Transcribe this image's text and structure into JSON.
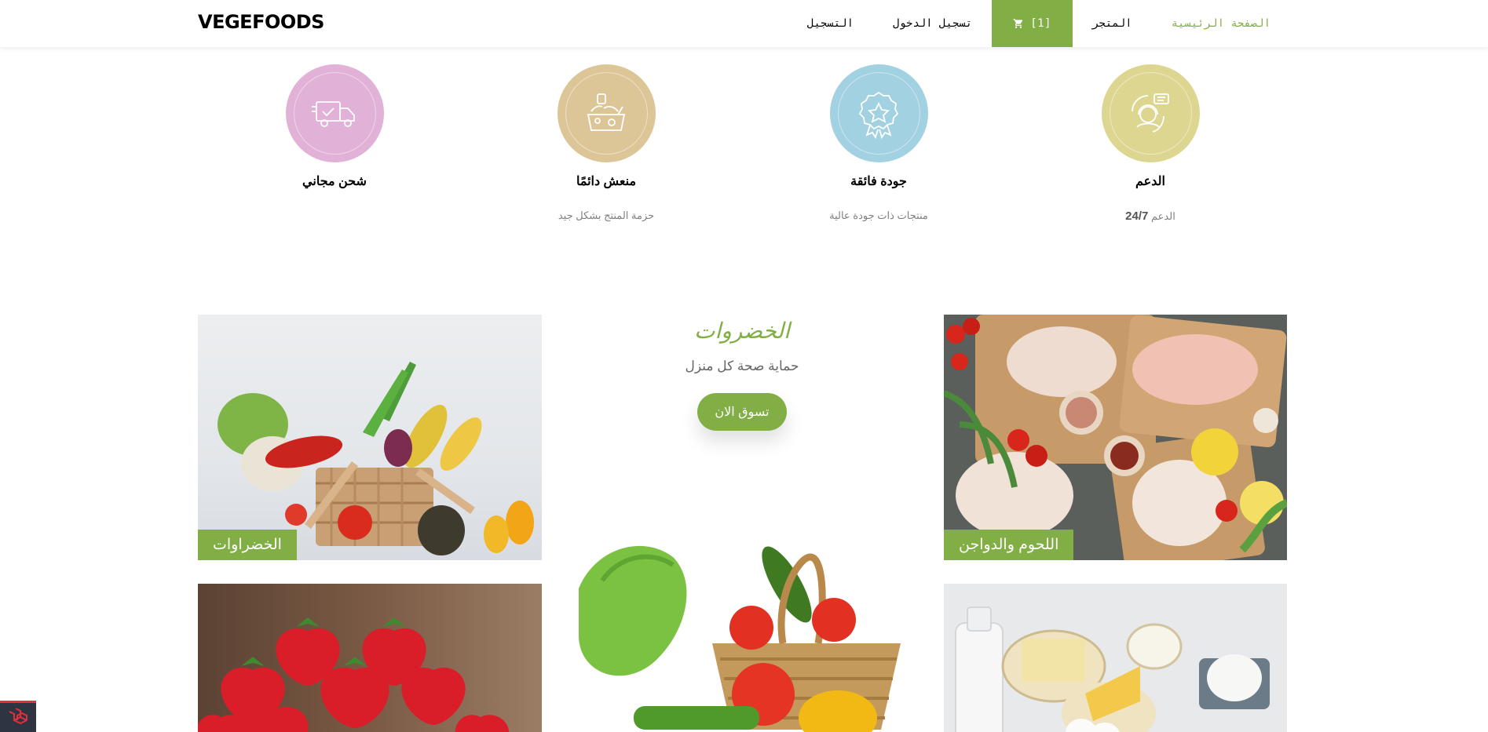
{
  "header": {
    "logo": "VEGEFOODS",
    "nav": {
      "home": "الصفحة الرئيسية",
      "store": "المتجر",
      "cart": "[1]",
      "login": "تسجيل الدخول",
      "register": "التسجيل"
    }
  },
  "services": [
    {
      "title": "شحن مجاني",
      "subtitle": "",
      "color": "#e2b1d8",
      "icon": "delivery-truck-icon"
    },
    {
      "title": "منعش دائمًا",
      "subtitle": "حزمة المنتج بشكل جيد",
      "color": "#dcc698",
      "icon": "grocery-bag-icon"
    },
    {
      "title": "جودة فائقة",
      "subtitle": "منتجات ذات جودة عالية",
      "color": "#a2d1e1",
      "icon": "quality-badge-icon"
    },
    {
      "title": "الدعم",
      "subtitle_text": "الدعم",
      "subtitle_num": "24/7",
      "color": "#dcd691",
      "icon": "support-agent-icon"
    }
  ],
  "categories": {
    "heading": "الخضروات",
    "tagline": "حماية صحة كل منزل",
    "shop_button": "تسوق الان",
    "vegetables_tag": "الخضراوات",
    "meat_tag": "اللحوم والدواجن"
  },
  "colors": {
    "accent": "#82ae46"
  }
}
